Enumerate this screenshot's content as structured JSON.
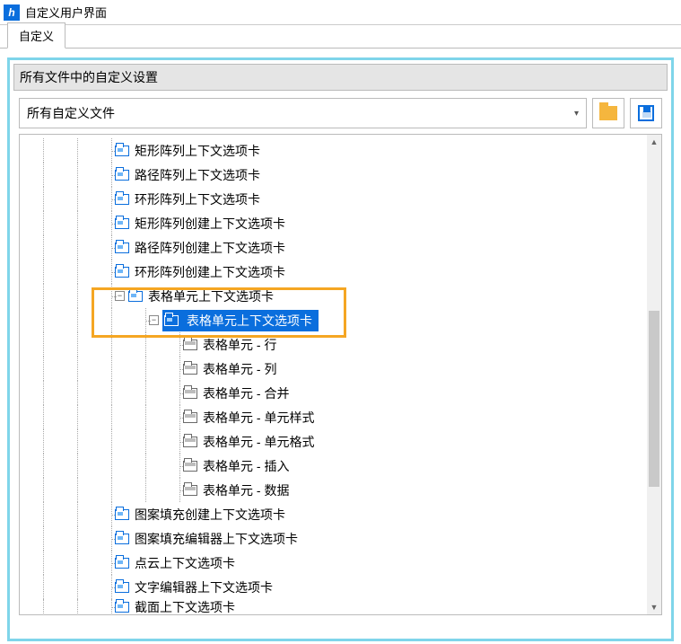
{
  "window": {
    "title": "自定义用户界面"
  },
  "tabs": {
    "active": "自定义"
  },
  "section": {
    "title": "所有文件中的自定义设置"
  },
  "fileSelect": {
    "value": "所有自定义文件"
  },
  "tree": {
    "items": [
      {
        "depth": 2,
        "icon": "tab",
        "label": "矩形阵列上下文选项卡"
      },
      {
        "depth": 2,
        "icon": "tab",
        "label": "路径阵列上下文选项卡"
      },
      {
        "depth": 2,
        "icon": "tab",
        "label": "环形阵列上下文选项卡"
      },
      {
        "depth": 2,
        "icon": "tab",
        "label": "矩形阵列创建上下文选项卡"
      },
      {
        "depth": 2,
        "icon": "tab",
        "label": "路径阵列创建上下文选项卡"
      },
      {
        "depth": 2,
        "icon": "tab",
        "label": "环形阵列创建上下文选项卡"
      },
      {
        "depth": 2,
        "icon": "tab",
        "label": "表格单元上下文选项卡",
        "expander": "minus"
      },
      {
        "depth": 3,
        "icon": "tab",
        "label": "表格单元上下文选项卡",
        "expander": "minus",
        "selected": true
      },
      {
        "depth": 4,
        "icon": "panel",
        "label": "表格单元 - 行"
      },
      {
        "depth": 4,
        "icon": "panel",
        "label": "表格单元 - 列"
      },
      {
        "depth": 4,
        "icon": "panel",
        "label": "表格单元 - 合并"
      },
      {
        "depth": 4,
        "icon": "panel",
        "label": "表格单元 - 单元样式"
      },
      {
        "depth": 4,
        "icon": "panel",
        "label": "表格单元 - 单元格式"
      },
      {
        "depth": 4,
        "icon": "panel",
        "label": "表格单元 - 插入"
      },
      {
        "depth": 4,
        "icon": "panel",
        "label": "表格单元 - 数据"
      },
      {
        "depth": 2,
        "icon": "tab",
        "label": "图案填充创建上下文选项卡"
      },
      {
        "depth": 2,
        "icon": "tab",
        "label": "图案填充编辑器上下文选项卡"
      },
      {
        "depth": 2,
        "icon": "tab",
        "label": "点云上下文选项卡"
      },
      {
        "depth": 2,
        "icon": "tab",
        "label": "文字编辑器上下文选项卡"
      },
      {
        "depth": 2,
        "icon": "tab",
        "label": "截面上下文选项卡",
        "cut": true
      }
    ]
  }
}
